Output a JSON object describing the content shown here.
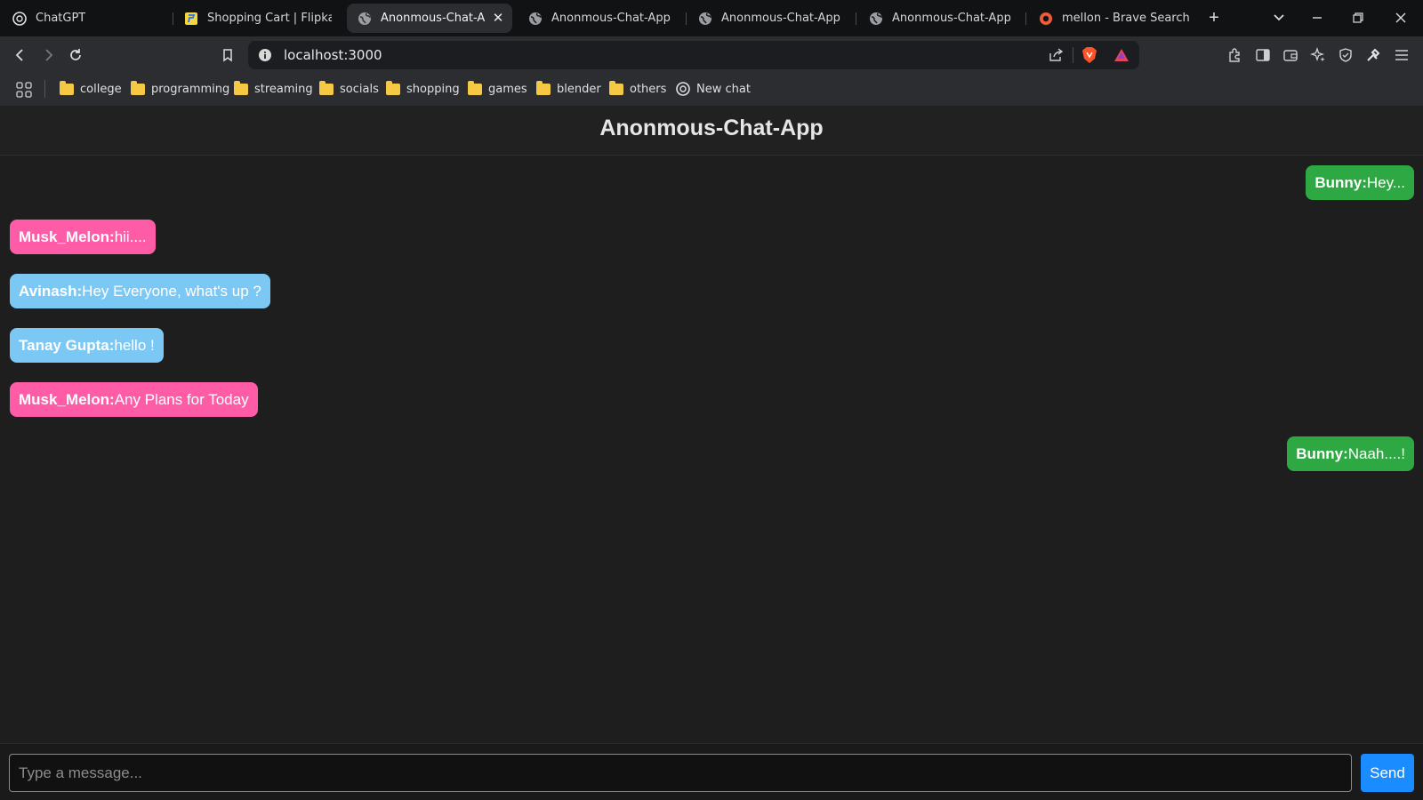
{
  "browser": {
    "tabs": [
      {
        "label": "ChatGPT",
        "icon": "chatgpt-icon"
      },
      {
        "label": "Shopping Cart | Flipkart.com",
        "icon": "flipkart-icon"
      },
      {
        "label": "Anonmous-Chat-App",
        "icon": "globe-icon",
        "active": true
      },
      {
        "label": "Anonmous-Chat-App",
        "icon": "globe-icon"
      },
      {
        "label": "Anonmous-Chat-App",
        "icon": "globe-icon"
      },
      {
        "label": "Anonmous-Chat-App",
        "icon": "globe-icon"
      },
      {
        "label": "mellon - Brave Search",
        "icon": "brave-search-icon"
      }
    ],
    "close_glyph": "✕",
    "new_tab_glyph": "+",
    "address": "localhost:3000",
    "bookmarks": [
      {
        "label": "college",
        "icon": "folder-icon"
      },
      {
        "label": "programming",
        "icon": "folder-icon"
      },
      {
        "label": "streaming",
        "icon": "folder-icon"
      },
      {
        "label": "socials",
        "icon": "folder-icon"
      },
      {
        "label": "shopping",
        "icon": "folder-icon"
      },
      {
        "label": "games",
        "icon": "folder-icon"
      },
      {
        "label": "blender",
        "icon": "folder-icon"
      },
      {
        "label": "others",
        "icon": "folder-icon"
      },
      {
        "label": "New chat",
        "icon": "chatgpt-icon"
      }
    ]
  },
  "app": {
    "title": "Anonmous-Chat-App",
    "messages": [
      {
        "user": "Bunny:",
        "text": "Hey...",
        "side": "right",
        "color": "#2ea843"
      },
      {
        "user": "Musk_Melon:",
        "text": "hii....",
        "side": "left",
        "color": "#ff5ca8"
      },
      {
        "user": "Avinash:",
        "text": "Hey Everyone, what's up ?",
        "side": "left",
        "color": "#7cc8f5"
      },
      {
        "user": "Tanay Gupta:",
        "text": "hello !",
        "side": "left",
        "color": "#7cc8f5"
      },
      {
        "user": "Musk_Melon:",
        "text": "Any Plans for Today",
        "side": "left",
        "color": "#ff5ca8"
      },
      {
        "user": "Bunny:",
        "text": "Naah....!",
        "side": "right",
        "color": "#2ea843"
      }
    ],
    "input": {
      "placeholder": "Type a message...",
      "value": ""
    },
    "send_label": "Send"
  }
}
